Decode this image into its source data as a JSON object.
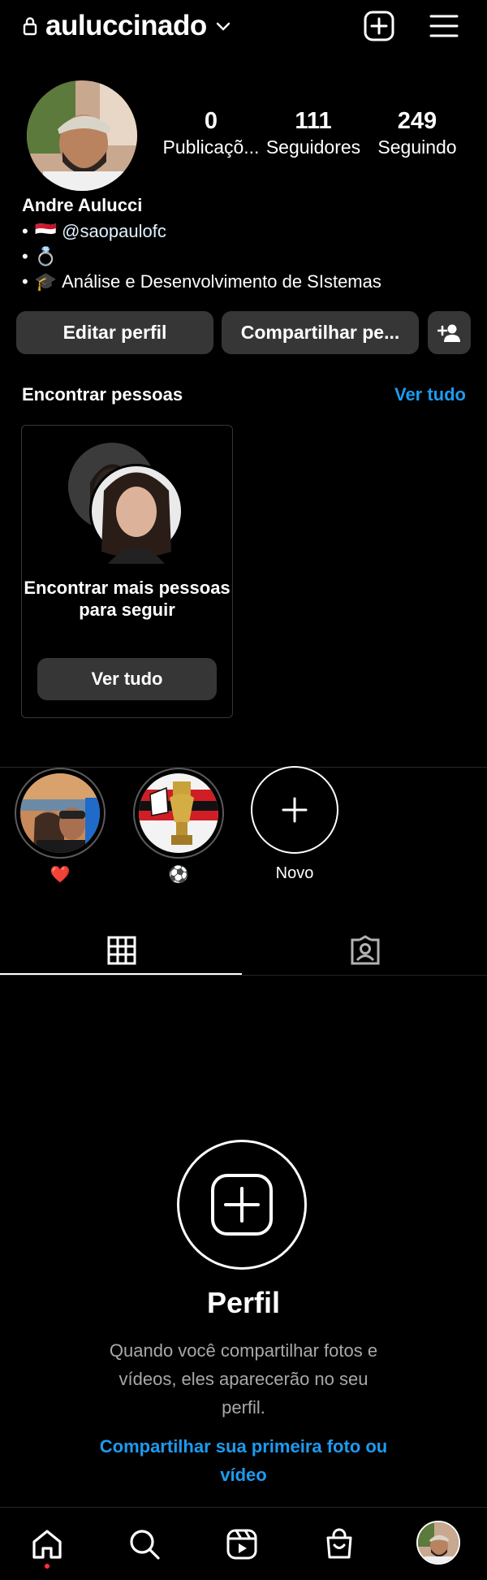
{
  "header": {
    "username": "auluccinado",
    "icons": [
      "lock-icon",
      "chevron-down-icon",
      "new-post-icon",
      "menu-icon"
    ]
  },
  "profile": {
    "stats": [
      {
        "value": "0",
        "label": "Publicaçõ..."
      },
      {
        "value": "111",
        "label": "Seguidores"
      },
      {
        "value": "249",
        "label": "Seguindo"
      }
    ],
    "full_name": "Andre Aulucci",
    "bio": [
      {
        "bullet": "•",
        "emoji": "🇾🇪",
        "text": "@saopaulofc"
      },
      {
        "bullet": "•",
        "emoji": "💍",
        "text": ""
      },
      {
        "bullet": "•",
        "emoji": "🎓",
        "text": "Análise e Desenvolvimento de SIstemas"
      }
    ]
  },
  "actions": {
    "edit_profile": "Editar perfil",
    "share_profile": "Compartilhar pe..."
  },
  "discover": {
    "title": "Encontrar pessoas",
    "see_all": "Ver tudo",
    "card_text": "Encontrar mais pessoas para seguir",
    "card_button": "Ver tudo"
  },
  "highlights": [
    {
      "caption": "❤️"
    },
    {
      "caption": "⚽"
    },
    {
      "caption": "Novo"
    }
  ],
  "empty_state": {
    "title": "Perfil",
    "description": "Quando você compartilhar fotos e vídeos, eles aparecerão no seu perfil.",
    "cta": "Compartilhar sua primeira foto ou vídeo"
  },
  "colors": {
    "background": "#000000",
    "button": "#363636",
    "accent_blue": "#1d9bf0",
    "notification_red": "#ff3040"
  }
}
